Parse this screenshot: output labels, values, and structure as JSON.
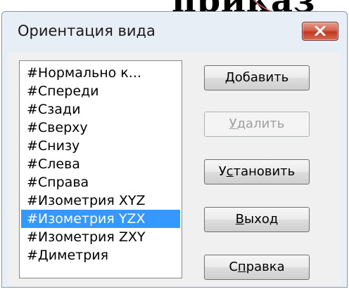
{
  "background": {
    "partial_text": "приказ"
  },
  "window": {
    "title": "Ориентация вида",
    "close_icon": "close-x-icon",
    "close_color": "#c0391f"
  },
  "list": {
    "items": [
      "#Нормально к...",
      "#Спереди",
      "#Сзади",
      "#Сверху",
      "#Снизу",
      "#Слева",
      "#Справа",
      "#Изометрия XYZ",
      "#Изометрия YZX",
      "#Изометрия ZXY",
      "#Диметрия"
    ],
    "selected_index": 8,
    "selected_color": "#3399ff"
  },
  "buttons": {
    "add": {
      "label": "Добавить",
      "mnemonic": "Д",
      "enabled": true
    },
    "delete": {
      "label": "Удалить",
      "mnemonic": "У",
      "enabled": false
    },
    "set": {
      "label": "Установить",
      "mnemonic": "с",
      "enabled": true
    },
    "exit": {
      "label": "Выход",
      "mnemonic": "В",
      "enabled": true
    },
    "help": {
      "label": "Справка",
      "mnemonic": "п",
      "enabled": true
    }
  }
}
